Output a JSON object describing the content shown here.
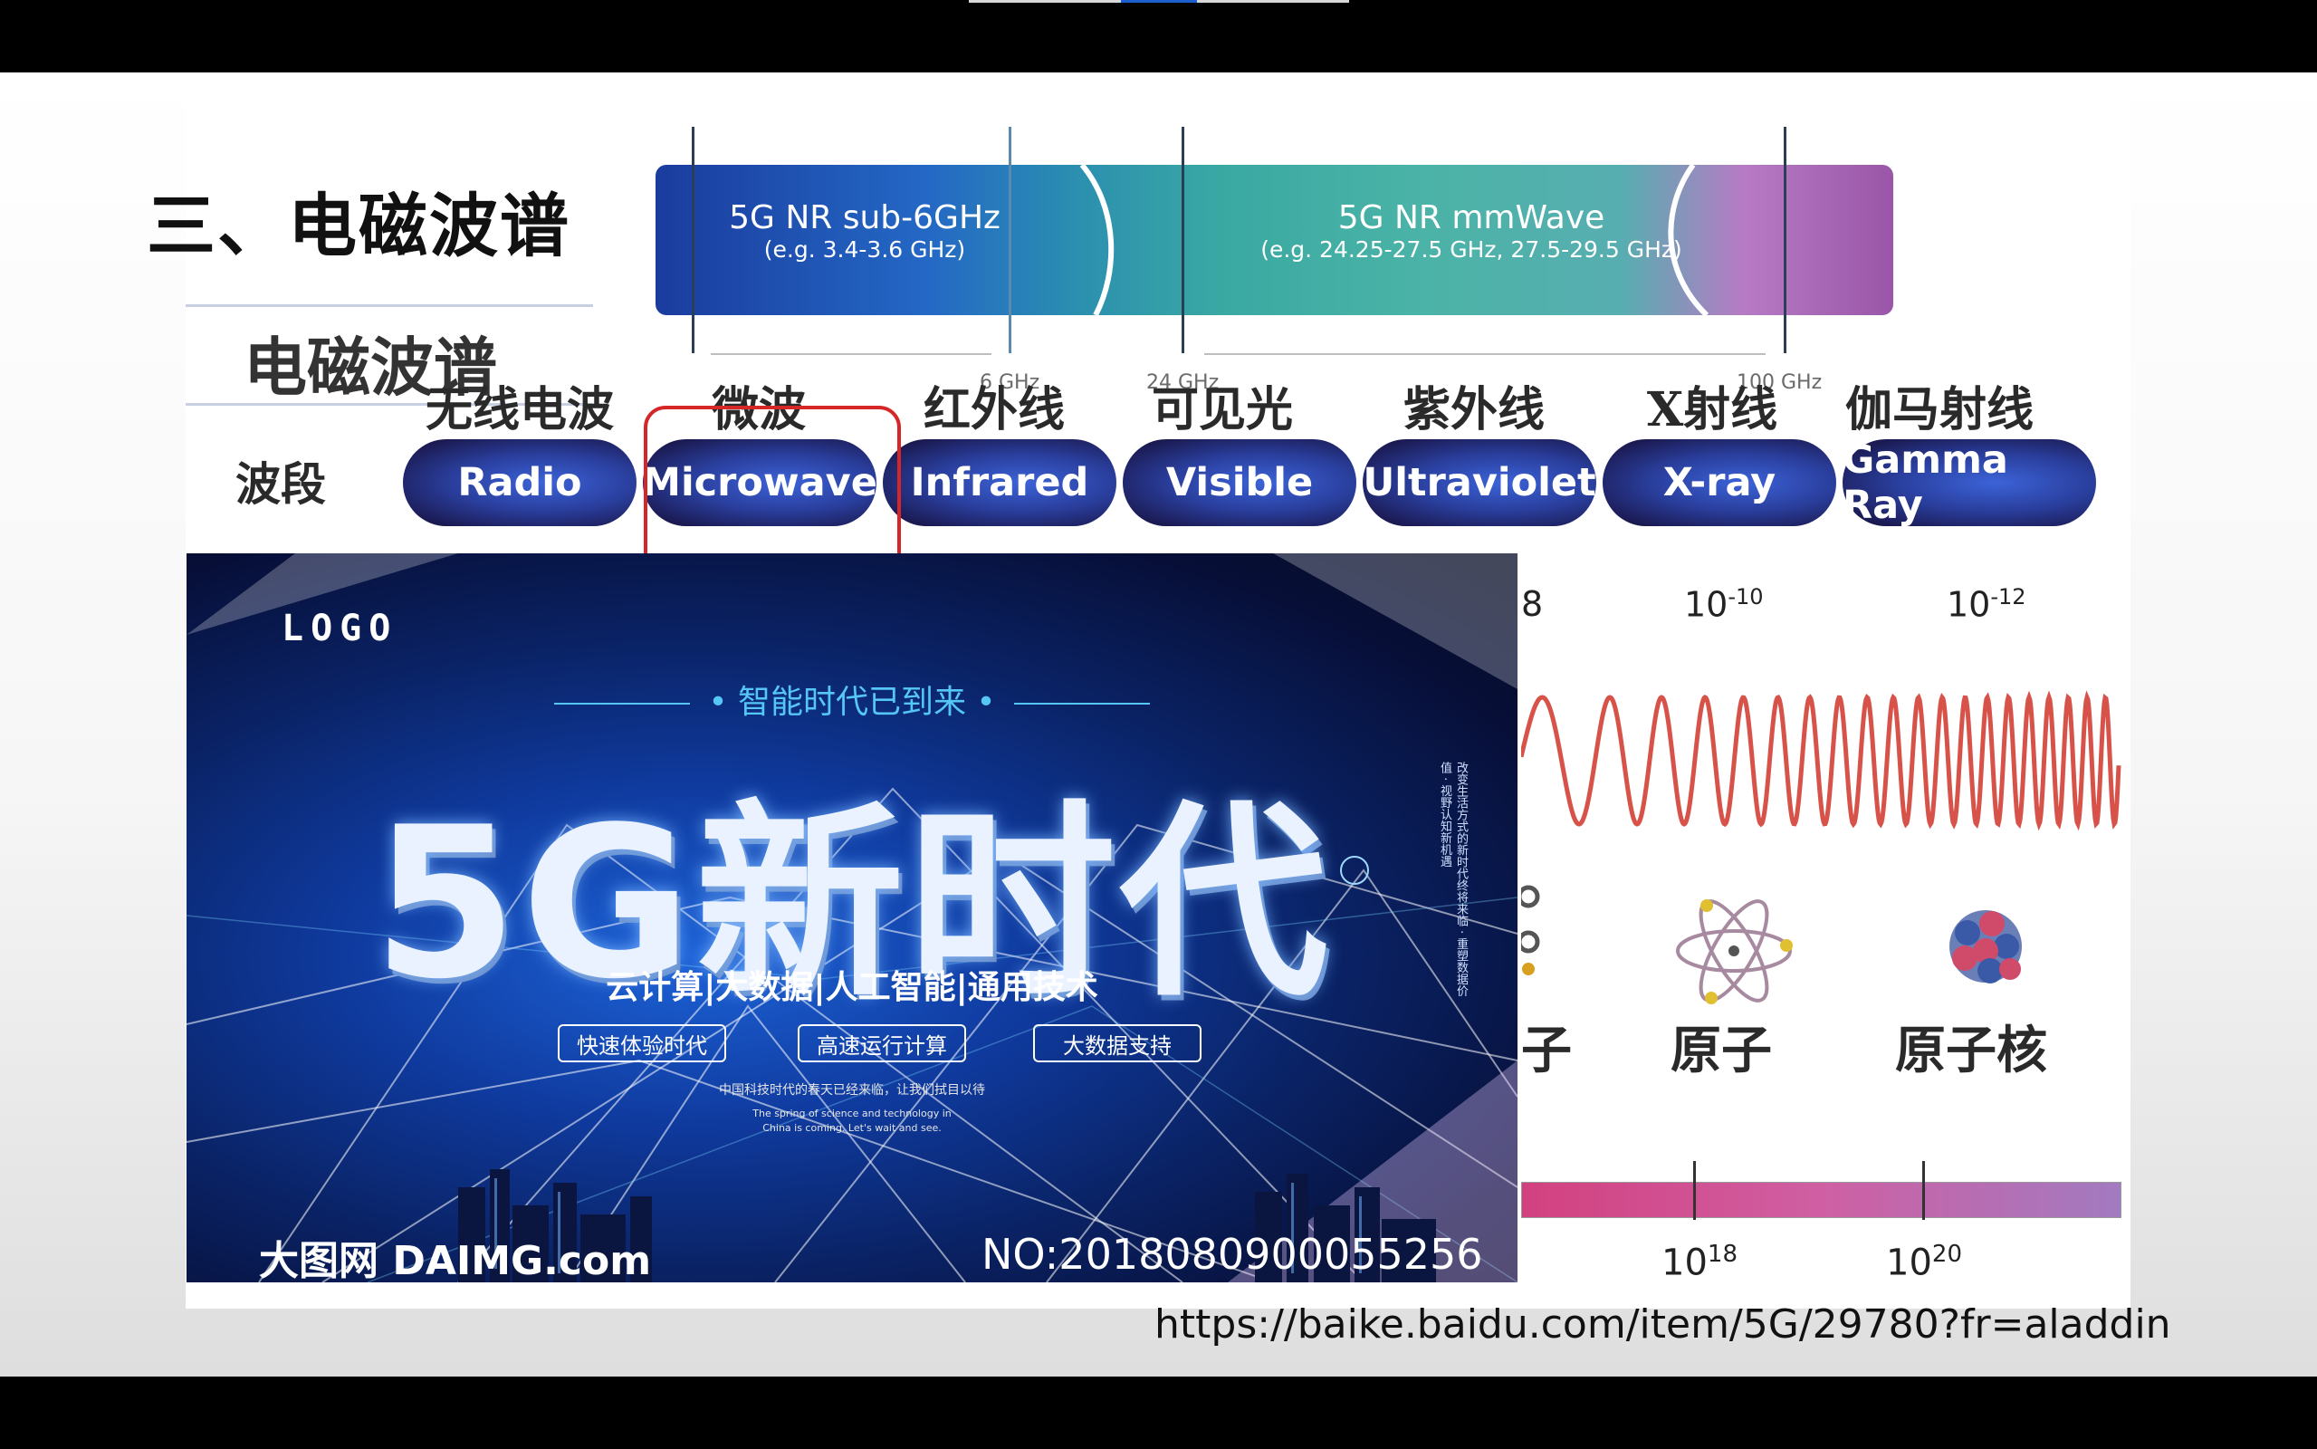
{
  "slide": {
    "title": "三、电磁波谱",
    "source_url": "https://baike.baidu.com/item/5G/29780?fr=aladdin"
  },
  "spectrum": {
    "heading": "电磁波谱",
    "row_label": "波段",
    "bands_top": [
      {
        "main": "5G NR sub-6GHz",
        "sub": "(e.g. 3.4-3.6 GHz)"
      },
      {
        "main": "5G NR mmWave",
        "sub": "(e.g. 24.25-27.5 GHz, 27.5-29.5 GHz)"
      }
    ],
    "freq_markers": [
      "6 GHz",
      "24 GHz",
      "100 GHz"
    ],
    "bands": [
      {
        "zh": "无线电波",
        "en": "Radio"
      },
      {
        "zh": "微波",
        "en": "Microwave"
      },
      {
        "zh": "红外线",
        "en": "Infrared"
      },
      {
        "zh": "可见光",
        "en": "Visible"
      },
      {
        "zh": "紫外线",
        "en": "Ultraviolet"
      },
      {
        "zh": "X射线",
        "en": "X-ray"
      },
      {
        "zh": "伽马射线",
        "en": "Gamma Ray"
      }
    ],
    "highlighted_band": "Microwave",
    "wavelength": {
      "partial": "8",
      "a_base": "10",
      "a_exp": "-10",
      "b_base": "10",
      "b_exp": "-12"
    },
    "objects": {
      "partial": "子",
      "atom": "原子",
      "nucleus": "原子核"
    },
    "frequency": {
      "a_base": "10",
      "a_exp": "18",
      "b_base": "10",
      "b_exp": "20"
    }
  },
  "poster": {
    "logo": "LOGO",
    "tagline": "• 智能时代已到来 •",
    "headline": "5G新时代",
    "keywords": "云计算|大数据|人工智能|通用技术",
    "buttons": [
      "快速体验时代",
      "高速运行计算",
      "大数据支持"
    ],
    "small_cn": "中国科技时代的春天已经来临，让我们拭目以待",
    "small_en_1": "The spring of science and technology in",
    "small_en_2": "China is coming. Let's wait and see.",
    "side_text": "改变生活方式的新时代终将来临 · 重塑数据价值 · 视野认知新机遇",
    "watermark_brand": "大图网 DAIMG.com",
    "watermark_no": "NO:20180809000552​56"
  },
  "colors": {
    "highlight": "#d62728",
    "pill_core": "#3c63d8",
    "wave": "#d0352a",
    "poster_accent": "#56c6f7"
  }
}
